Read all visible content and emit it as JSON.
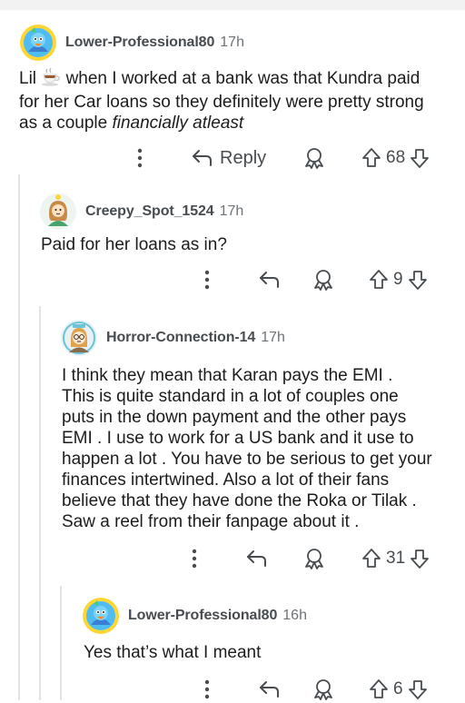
{
  "comments": [
    {
      "username": "Lower-Professional80",
      "time": "17h",
      "text_line1_a": "Lil",
      "text_line1_b": "when I worked at a bank was that Kundra paid",
      "text_line2": "for her Car loans so they definitely were pretty strong",
      "text_line3_a": "as a couple ",
      "text_line3_b": "financially atleast",
      "reply_label": "Reply",
      "votes": "68"
    },
    {
      "username": "Creepy_Spot_1524",
      "time": "17h",
      "text": "Paid for her loans as in?",
      "votes": "9"
    },
    {
      "username": "Horror-Connection-14",
      "time": "17h",
      "lines": [
        "I think they mean that Karan pays the EMI .",
        "This is quite standard in a lot of couples one",
        "puts in the down payment and the other pays",
        "EMI . I use to work for a US bank and it use to",
        "happen a lot . You have to be serious to get your",
        "finances intertwined. Also a lot of their fans",
        "believe that they have done the Roka or Tilak .",
        "Saw a reel from their fanpage about it ."
      ],
      "votes": "31"
    },
    {
      "username": "Lower-Professional80",
      "time": "16h",
      "text": "Yes that’s what I meant",
      "votes": "6"
    }
  ],
  "icons": {
    "more": "more-vertical-icon",
    "reply": "reply-arrow-icon",
    "award": "award-icon",
    "upvote": "upvote-icon",
    "downvote": "downvote-icon",
    "tea": "tea-cup-emoji"
  },
  "colors": {
    "text": "#1c1c1c",
    "meta": "#474c50",
    "thread_line": "#e3e3e3"
  }
}
